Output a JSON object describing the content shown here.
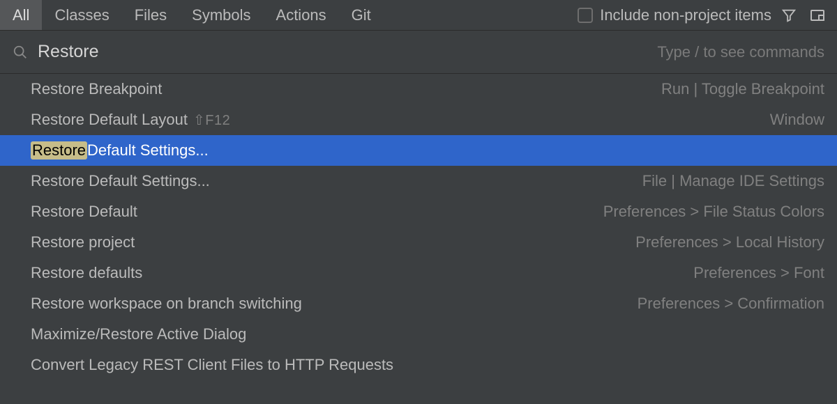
{
  "tabs": {
    "all": "All",
    "classes": "Classes",
    "files": "Files",
    "symbols": "Symbols",
    "actions": "Actions",
    "git": "Git"
  },
  "toolbar": {
    "include_label": "Include non-project items"
  },
  "search": {
    "value": "Restore",
    "hint": "Type / to see commands"
  },
  "results": [
    {
      "label": "Restore Breakpoint",
      "hint": "Run | Toggle Breakpoint",
      "shortcut": ""
    },
    {
      "label": "Restore Default Layout",
      "hint": "Window",
      "shortcut": "⇧F12"
    },
    {
      "highlight": "Restore",
      "rest": " Default Settings...",
      "hint": "",
      "shortcut": "",
      "selected": true
    },
    {
      "label": "Restore Default Settings...",
      "hint": "File | Manage IDE Settings",
      "shortcut": ""
    },
    {
      "label": "Restore Default",
      "hint": "Preferences > File Status Colors",
      "shortcut": ""
    },
    {
      "label": "Restore project",
      "hint": "Preferences > Local History",
      "shortcut": ""
    },
    {
      "label": "Restore defaults",
      "hint": "Preferences > Font",
      "shortcut": ""
    },
    {
      "label": "Restore workspace on branch switching",
      "hint": "Preferences > Confirmation",
      "shortcut": ""
    },
    {
      "label": "Maximize/Restore Active Dialog",
      "hint": "",
      "shortcut": ""
    },
    {
      "label": "Convert Legacy REST Client Files to HTTP Requests",
      "hint": "",
      "shortcut": ""
    }
  ]
}
